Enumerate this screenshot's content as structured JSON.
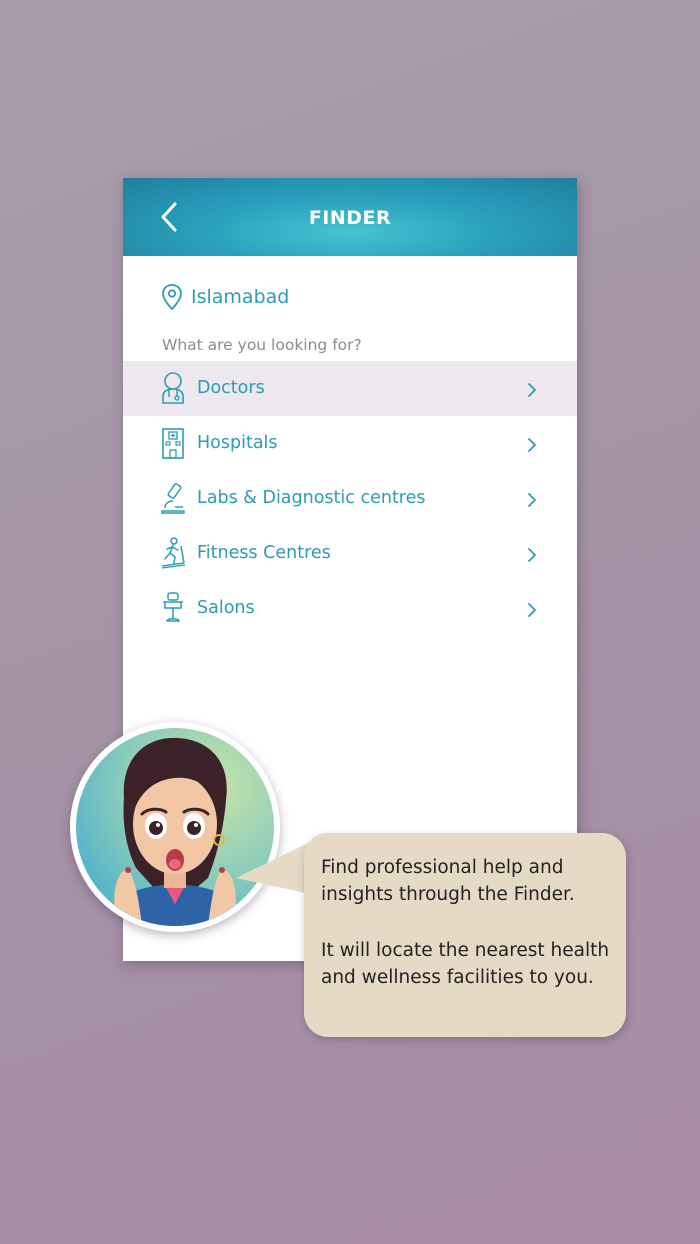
{
  "header": {
    "title": "FINDER",
    "back_icon": "chevron-left-icon"
  },
  "location": {
    "icon": "map-pin-icon",
    "city": "Islamabad"
  },
  "prompt": "What are you looking for?",
  "categories": [
    {
      "label": "Doctors",
      "icon": "doctor-icon",
      "selected": true
    },
    {
      "label": "Hospitals",
      "icon": "hospital-icon",
      "selected": false
    },
    {
      "label": "Labs & Diagnostic centres",
      "icon": "microscope-icon",
      "selected": false
    },
    {
      "label": "Fitness Centres",
      "icon": "treadmill-icon",
      "selected": false
    },
    {
      "label": "Salons",
      "icon": "salon-chair-icon",
      "selected": false
    }
  ],
  "tip": {
    "paragraph1": "Find professional help and insights through the Finder.",
    "paragraph2": "It will locate the nearest health and wellness facilities to you."
  },
  "colors": {
    "accent": "#2b9cb3",
    "header_gradient": [
      "#47c2d2",
      "#1f7e9e"
    ],
    "selected_row": "#ece8ee",
    "bubble": "#e6dac6",
    "background": "#a896a7"
  }
}
